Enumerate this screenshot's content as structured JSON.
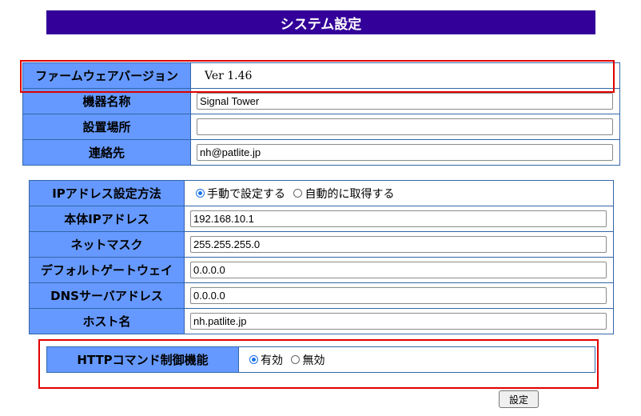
{
  "title": "システム設定",
  "device": {
    "firmware_label": "ファームウェアバージョン",
    "firmware_value": "Ver 1.46",
    "name_label": "機器名称",
    "name_value": "Signal Tower",
    "location_label": "設置場所",
    "location_value": "",
    "contact_label": "連絡先",
    "contact_value": "nh@patlite.jp"
  },
  "network": {
    "ip_method_label": "IPアドレス設定方法",
    "ip_method_options": [
      "手動で設定する",
      "自動的に取得する"
    ],
    "ip_method_selected": "手動で設定する",
    "ip_label": "本体IPアドレス",
    "ip_value": "192.168.10.1",
    "netmask_label": "ネットマスク",
    "netmask_value": "255.255.255.0",
    "gateway_label": "デフォルトゲートウェイ",
    "gateway_value": "0.0.0.0",
    "dns_label": "DNSサーバアドレス",
    "dns_value": "0.0.0.0",
    "host_label": "ホスト名",
    "host_value": "nh.patlite.jp"
  },
  "http": {
    "label": "HTTPコマンド制御機能",
    "options": [
      "有効",
      "無効"
    ],
    "selected": "有効"
  },
  "submit_label": "設定",
  "colors": {
    "banner": "#330099",
    "label_cell": "#6699ff",
    "highlight": "#e00000"
  }
}
